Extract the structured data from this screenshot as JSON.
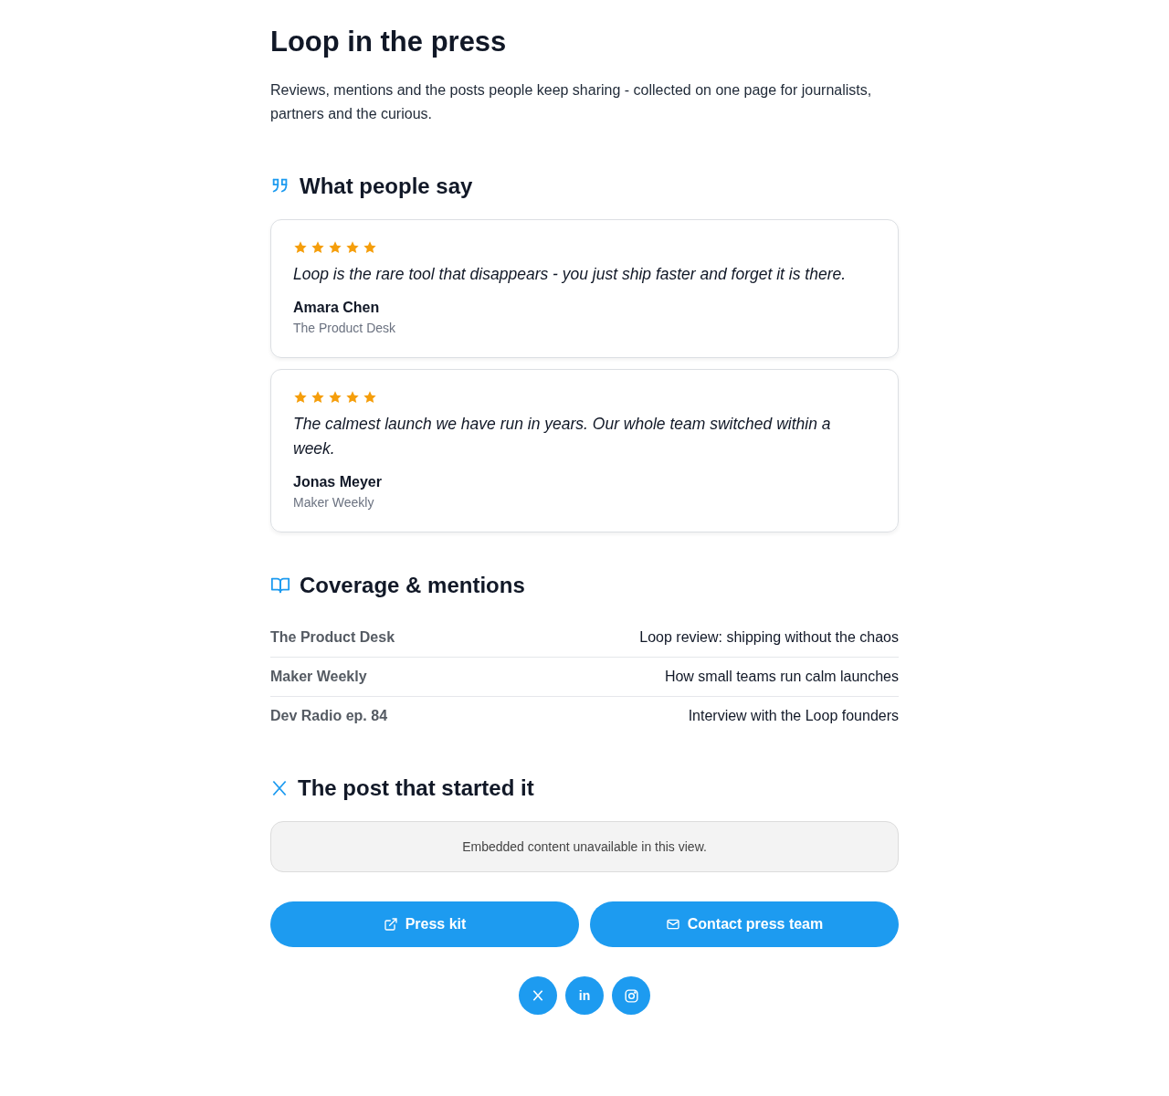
{
  "title": "Loop in the press",
  "intro": "Reviews, mentions and the posts people keep sharing - collected on one page for journalists, partners and the curious.",
  "testimonials_section": {
    "kind": "quote",
    "heading": "What people say"
  },
  "testimonials": [
    {
      "stars": 5,
      "quote": "Loop is the rare tool that disappears - you just ship faster and forget it is there.",
      "name": "Amara Chen",
      "outlet": "The Product Desk"
    },
    {
      "stars": 5,
      "quote": "The calmest launch we have run in years. Our whole team switched within a week.",
      "name": "Jonas Meyer",
      "outlet": "Maker Weekly"
    }
  ],
  "coverage_section": {
    "kind": "book",
    "heading": "Coverage & mentions"
  },
  "coverage": [
    {
      "outlet": "The Product Desk",
      "headline": "Loop review: shipping without the chaos"
    },
    {
      "outlet": "Maker Weekly",
      "headline": "How small teams run calm launches"
    },
    {
      "outlet": "Dev Radio ep. 84",
      "headline": "Interview with the Loop founders"
    }
  ],
  "post_section": {
    "kind": "x",
    "heading": "The post that started it"
  },
  "embed": {
    "message": "Embedded content unavailable in this view."
  },
  "buttons": [
    {
      "kind": "external",
      "label": "Press kit"
    },
    {
      "kind": "mail",
      "label": "Contact press team"
    }
  ],
  "social": [
    {
      "kind": "x"
    },
    {
      "kind": "linkedin",
      "label": "in"
    },
    {
      "kind": "instagram"
    }
  ]
}
